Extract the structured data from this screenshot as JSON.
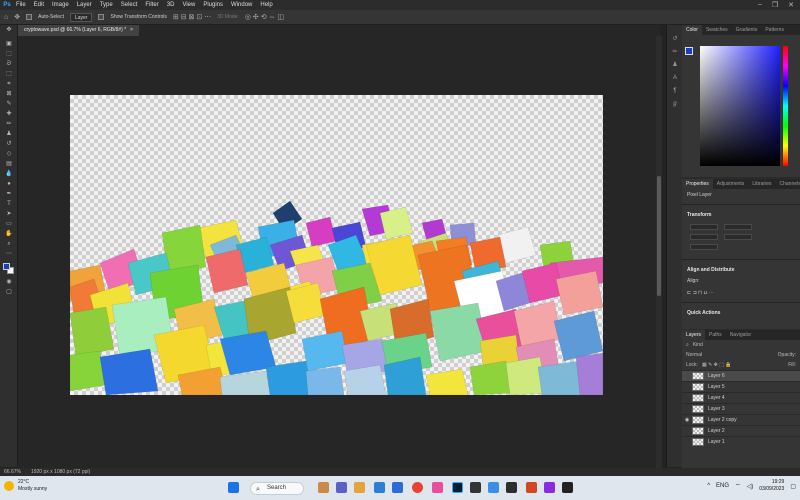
{
  "menubar": {
    "logo": "Ps",
    "items": [
      "File",
      "Edit",
      "Image",
      "Layer",
      "Type",
      "Select",
      "Filter",
      "3D",
      "View",
      "Plugins",
      "Window",
      "Help"
    ],
    "window_controls": [
      "–",
      "❐",
      "✕"
    ]
  },
  "options": {
    "auto_select_label": "Auto-Select",
    "auto_select_target": "Layer",
    "show_transform_label": "Show Transform Controls",
    "mode_3d_label": "3D Mode:"
  },
  "document": {
    "tab_title": "cryptowave.psd @ 66.7% (Layer 6, RGB/8#) *",
    "tab_close": "×"
  },
  "statusbar": {
    "zoom": "66.67%",
    "doc_size": "1920 px x 1080 px (72 ppi)"
  },
  "color_panel": {
    "tabs": [
      "Color",
      "Swatches",
      "Gradients",
      "Patterns"
    ],
    "foreground": "#1c3cc4",
    "background": "#ffffff"
  },
  "properties_panel": {
    "tabs": [
      "Properties",
      "Adjustments",
      "Libraries",
      "Channels"
    ],
    "layer_kind": "Pixel Layer",
    "transform_heading": "Transform",
    "align_heading": "Align and Distribute",
    "align_label": "Align:",
    "quick_actions_heading": "Quick Actions"
  },
  "layers_panel": {
    "tabs": [
      "Layers",
      "Paths",
      "Navigator"
    ],
    "filter_kind": "Kind",
    "blend_mode": "Normal",
    "opacity_label": "Opacity:",
    "lock_label": "Lock:",
    "fill_label": "Fill:",
    "layers": [
      {
        "name": "Layer 6",
        "selected": true,
        "visible": false
      },
      {
        "name": "Layer 5",
        "selected": false,
        "visible": false
      },
      {
        "name": "Layer 4",
        "selected": false,
        "visible": false
      },
      {
        "name": "Layer 3",
        "selected": false,
        "visible": false
      },
      {
        "name": "Layer 2 copy",
        "selected": false,
        "visible": true
      },
      {
        "name": "Layer 2",
        "selected": false,
        "visible": false
      },
      {
        "name": "Layer 1",
        "selected": false,
        "visible": false
      }
    ]
  },
  "taskbar": {
    "weather_temp": "22°C",
    "weather_desc": "Mostly sunny",
    "search_placeholder": "Search",
    "time": "19:29",
    "date": "03/09/2023",
    "language": "ENG"
  },
  "icons": {
    "tools": [
      "move-icon",
      "artboard-icon",
      "marquee-icon",
      "lasso-icon",
      "object-select-icon",
      "crop-icon",
      "frame-icon",
      "eyedropper-icon",
      "healing-icon",
      "brush-icon",
      "stamp-icon",
      "history-brush-icon",
      "eraser-icon",
      "gradient-icon",
      "blur-icon",
      "dodge-icon",
      "pen-icon",
      "type-icon",
      "path-select-icon",
      "shape-icon",
      "hand-icon",
      "zoom-icon",
      "more-tools-icon"
    ]
  }
}
